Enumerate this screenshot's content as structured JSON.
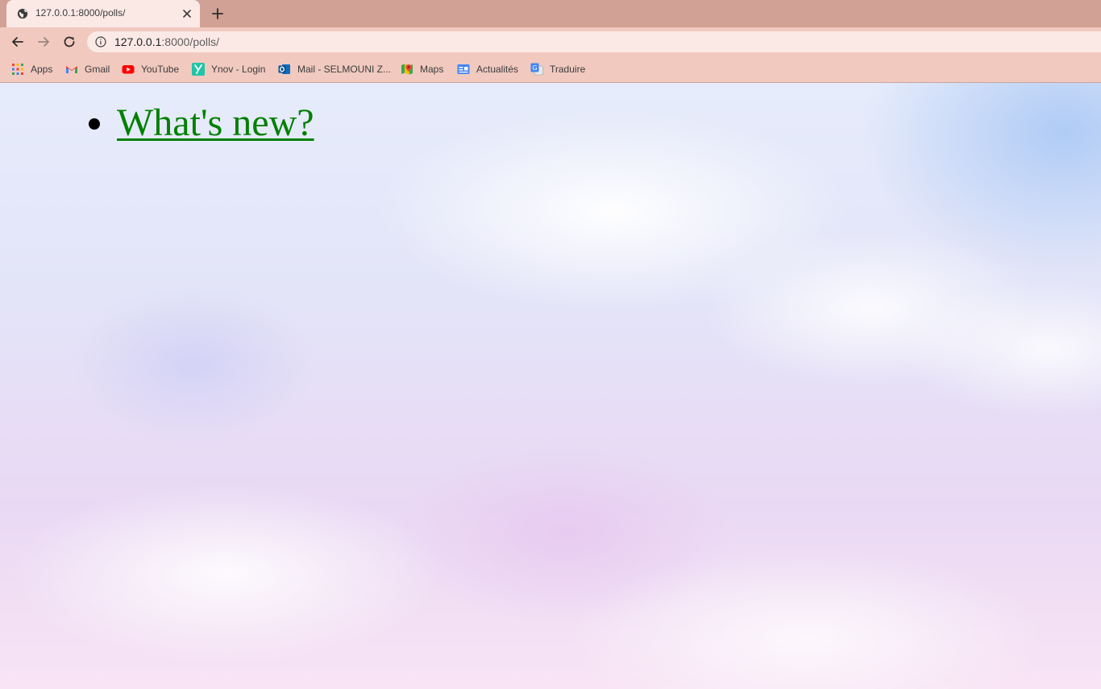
{
  "tab": {
    "title": "127.0.0.1:8000/polls/",
    "favicon": "globe-icon"
  },
  "toolbar": {
    "url_host": "127.0.0.1",
    "url_rest": ":8000/polls/"
  },
  "bookmarks": [
    {
      "label": "Apps",
      "icon": "apps-grid-icon"
    },
    {
      "label": "Gmail",
      "icon": "gmail-icon"
    },
    {
      "label": "YouTube",
      "icon": "youtube-icon"
    },
    {
      "label": "Ynov - Login",
      "icon": "ynov-icon"
    },
    {
      "label": "Mail - SELMOUNI Z...",
      "icon": "outlook-icon"
    },
    {
      "label": "Maps",
      "icon": "maps-icon"
    },
    {
      "label": "Actualités",
      "icon": "news-icon"
    },
    {
      "label": "Traduire",
      "icon": "translate-icon"
    }
  ],
  "page": {
    "questions": [
      {
        "text": "What's new?"
      }
    ]
  },
  "colors": {
    "tabstrip": "#d0a194",
    "toolbar": "#f1c9bf",
    "active_tab": "#fbe9e6",
    "link": "#008000"
  }
}
